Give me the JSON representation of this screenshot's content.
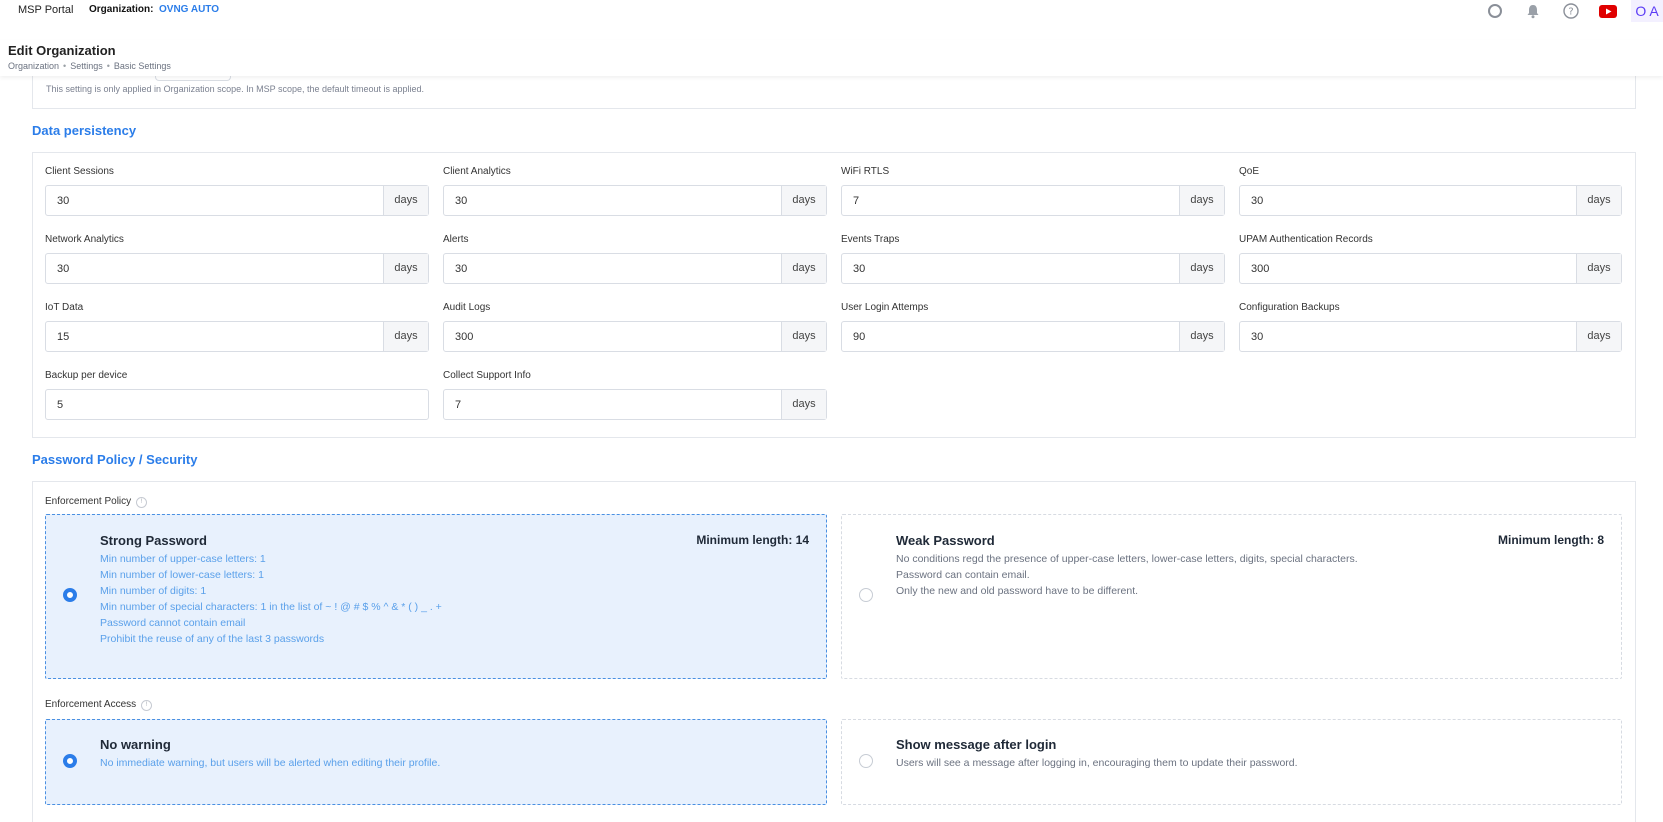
{
  "topbar": {
    "brand": "MSP Portal",
    "org_label": "Organization:",
    "org_value": "OVNG AUTO",
    "icons": [
      "search-icon",
      "bell-icon",
      "help-icon",
      "youtube-icon"
    ],
    "avatar": "O A"
  },
  "header": {
    "title": "Edit Organization",
    "breadcrumb": [
      "Organization",
      "Settings",
      "Basic Settings"
    ]
  },
  "scope_note": "This setting is only applied in Organization scope. In MSP scope, the default timeout is applied.",
  "data_persistency": {
    "title": "Data persistency",
    "fields": [
      {
        "label": "Client Sessions",
        "value": "30",
        "unit": "days"
      },
      {
        "label": "Client Analytics",
        "value": "30",
        "unit": "days"
      },
      {
        "label": "WiFi RTLS",
        "value": "7",
        "unit": "days"
      },
      {
        "label": "QoE",
        "value": "30",
        "unit": "days"
      },
      {
        "label": "Network Analytics",
        "value": "30",
        "unit": "days"
      },
      {
        "label": "Alerts",
        "value": "30",
        "unit": "days"
      },
      {
        "label": "Events Traps",
        "value": "30",
        "unit": "days"
      },
      {
        "label": "UPAM Authentication Records",
        "value": "300",
        "unit": "days"
      },
      {
        "label": "IoT Data",
        "value": "15",
        "unit": "days"
      },
      {
        "label": "Audit Logs",
        "value": "300",
        "unit": "days"
      },
      {
        "label": "User Login Attemps",
        "value": "90",
        "unit": "days"
      },
      {
        "label": "Configuration Backups",
        "value": "30",
        "unit": "days"
      },
      {
        "label": "Backup per device",
        "value": "5",
        "unit": ""
      },
      {
        "label": "Collect Support Info",
        "value": "7",
        "unit": "days"
      }
    ]
  },
  "password_policy": {
    "title": "Password Policy / Security",
    "enforcement_policy_label": "Enforcement Policy",
    "strong": {
      "title": "Strong Password",
      "min_length": "Minimum length: 14",
      "lines": [
        "Min number of upper-case letters: 1",
        "Min number of lower-case letters: 1",
        "Min number of digits: 1",
        "Min number of special characters: 1 in the list of ~ ! @ # $ % ^ & * ( ) _ . +",
        "Password cannot contain email",
        "Prohibit the reuse of any of the last 3 passwords"
      ],
      "selected": true
    },
    "weak": {
      "title": "Weak Password",
      "min_length": "Minimum length: 8",
      "lines": [
        "No conditions regd the presence of upper-case letters, lower-case letters, digits, special characters.",
        "Password can contain email.",
        "Only the new and old password have to be different."
      ],
      "selected": false
    },
    "enforcement_access_label": "Enforcement Access",
    "no_warning": {
      "title": "No warning",
      "desc": "No immediate warning, but users will be alerted when editing their profile.",
      "selected": true
    },
    "show_message": {
      "title": "Show message after login",
      "desc": "Users will see a message after logging in, encouraging them to update their password.",
      "selected": false
    }
  },
  "colors": {
    "accent": "#2b7de9",
    "selected_card_bg": "#e8f1fd",
    "youtube": "#e00000",
    "avatar_text": "#5b3cf5"
  }
}
